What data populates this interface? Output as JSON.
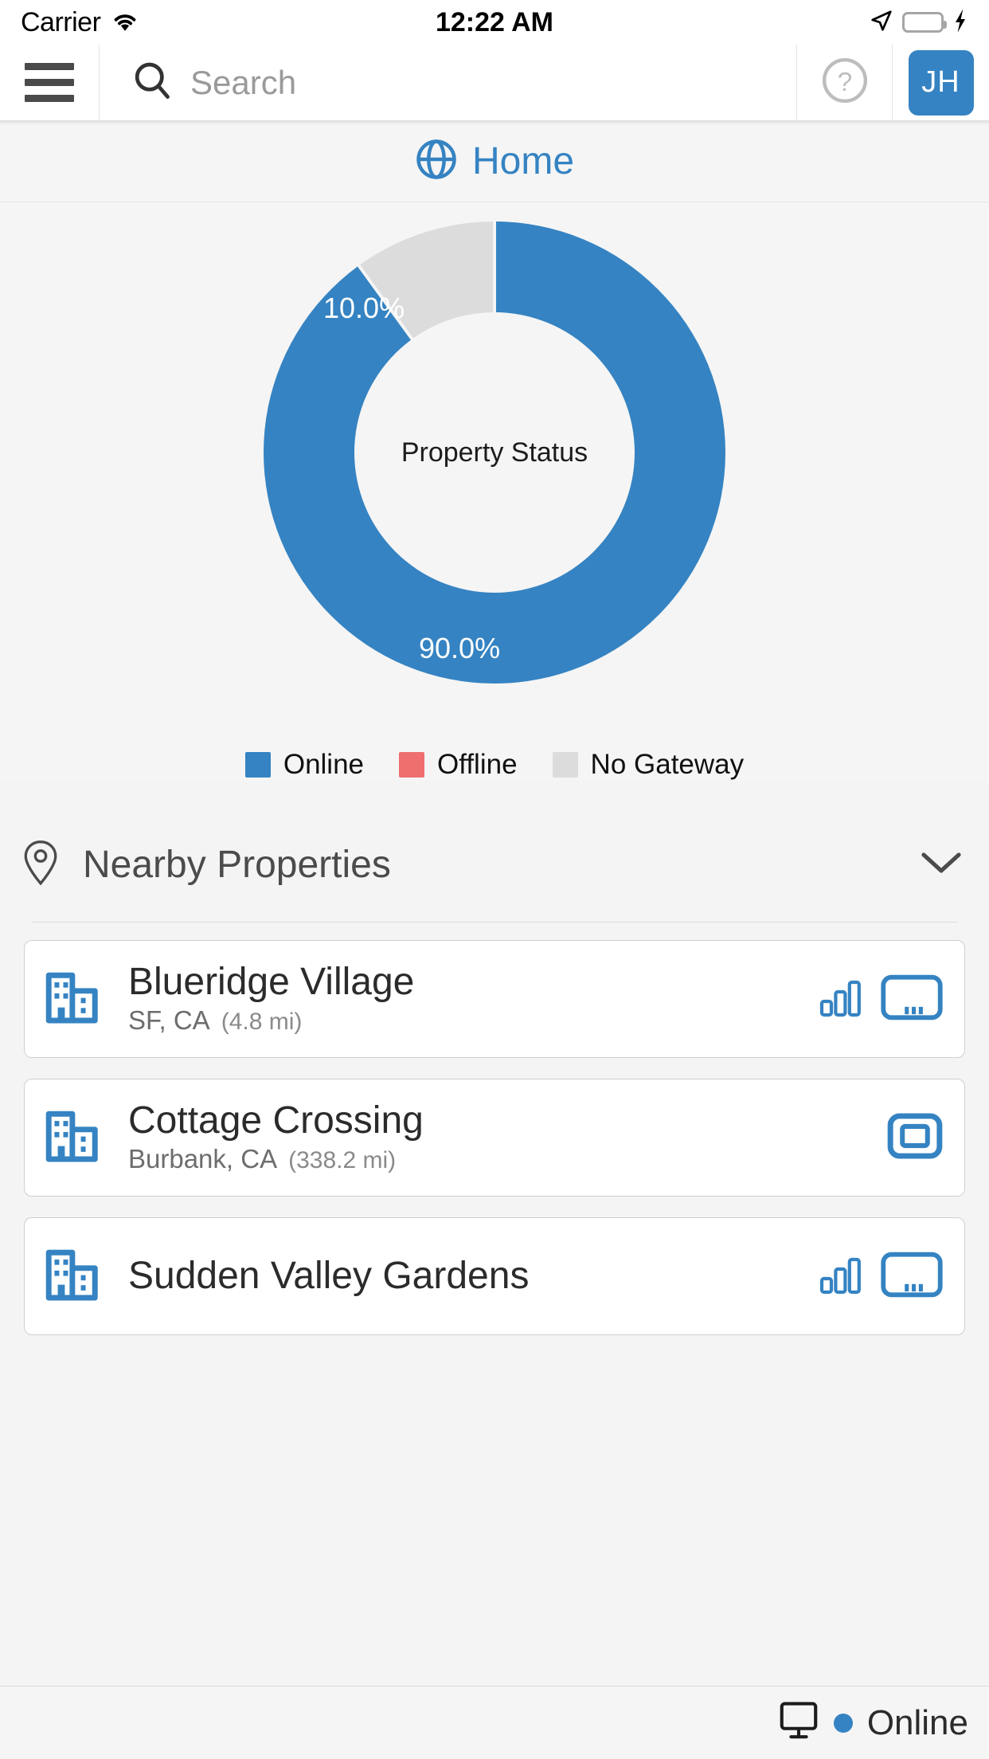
{
  "status_bar": {
    "carrier": "Carrier",
    "time": "12:22 AM",
    "wifi_icon": "wifi-icon",
    "location_icon": "location-arrow-icon",
    "battery_icon": "battery-full-icon",
    "charging_icon": "lightning-bolt-icon"
  },
  "app_bar": {
    "menu_icon": "hamburger-menu-icon",
    "search_icon": "search-icon",
    "search_placeholder": "Search",
    "search_value": "",
    "help_icon": "question-circle-icon",
    "avatar_initials": "JH"
  },
  "page": {
    "globe_icon": "globe-icon",
    "title": "Home"
  },
  "chart_data": {
    "type": "pie",
    "variant": "donut",
    "title": "Property Status",
    "center_label": "Property Status",
    "categories": [
      "Online",
      "Offline",
      "No Gateway"
    ],
    "values": [
      90.0,
      0.0,
      10.0
    ],
    "value_labels": [
      "90.0%",
      "10.0%"
    ],
    "colors": [
      "#3583c2",
      "#ef6f6f",
      "#dcdcdc"
    ],
    "legend": [
      {
        "label": "Online",
        "color": "#3583c2"
      },
      {
        "label": "Offline",
        "color": "#ef6f6f"
      },
      {
        "label": "No Gateway",
        "color": "#dcdcdc"
      }
    ],
    "legend_position": "bottom",
    "grid": false
  },
  "nearby": {
    "pin_icon": "map-pin-icon",
    "title": "Nearby Properties",
    "collapse_icon": "chevron-down-icon",
    "properties": [
      {
        "building_icon": "building-icon",
        "name": "Blueridge Village",
        "location": "SF, CA",
        "distance": "(4.8 mi)",
        "icons": [
          "signal-bars-icon",
          "gateway-device-icon"
        ]
      },
      {
        "building_icon": "building-icon",
        "name": "Cottage Crossing",
        "location": "Burbank, CA",
        "distance": "(338.2 mi)",
        "icons": [
          "thermostat-device-icon"
        ]
      },
      {
        "building_icon": "building-icon",
        "name": "Sudden Valley Gardens",
        "location": "",
        "distance": "",
        "icons": [
          "signal-bars-icon",
          "gateway-device-icon"
        ]
      }
    ]
  },
  "bottom_status": {
    "monitor_icon": "monitor-icon",
    "status_color": "#3583c2",
    "status_text": "Online"
  },
  "theme": {
    "accent": "#3583c2",
    "offline": "#ef6f6f",
    "no_gateway": "#dcdcdc",
    "page_bg": "#f5f5f5"
  }
}
